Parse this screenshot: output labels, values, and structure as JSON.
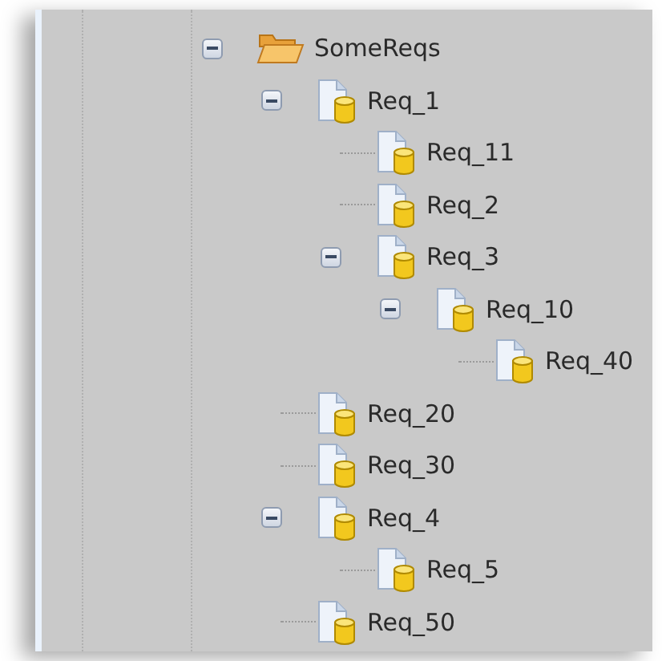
{
  "tree": [
    {
      "label": "SomeReqs",
      "kind": "folder",
      "expanded": true,
      "children": [
        {
          "label": "Req_1",
          "kind": "requirement",
          "expanded": true,
          "children": [
            {
              "label": "Req_11",
              "kind": "requirement"
            },
            {
              "label": "Req_2",
              "kind": "requirement"
            },
            {
              "label": "Req_3",
              "kind": "requirement",
              "expanded": true,
              "children": [
                {
                  "label": "Req_10",
                  "kind": "requirement",
                  "expanded": true,
                  "children": [
                    {
                      "label": "Req_40",
                      "kind": "requirement"
                    }
                  ]
                }
              ]
            }
          ]
        },
        {
          "label": "Req_20",
          "kind": "requirement"
        },
        {
          "label": "Req_30",
          "kind": "requirement"
        },
        {
          "label": "Req_4",
          "kind": "requirement",
          "expanded": true,
          "children": [
            {
              "label": "Req_5",
              "kind": "requirement"
            }
          ]
        },
        {
          "label": "Req_50",
          "kind": "requirement"
        }
      ]
    }
  ]
}
